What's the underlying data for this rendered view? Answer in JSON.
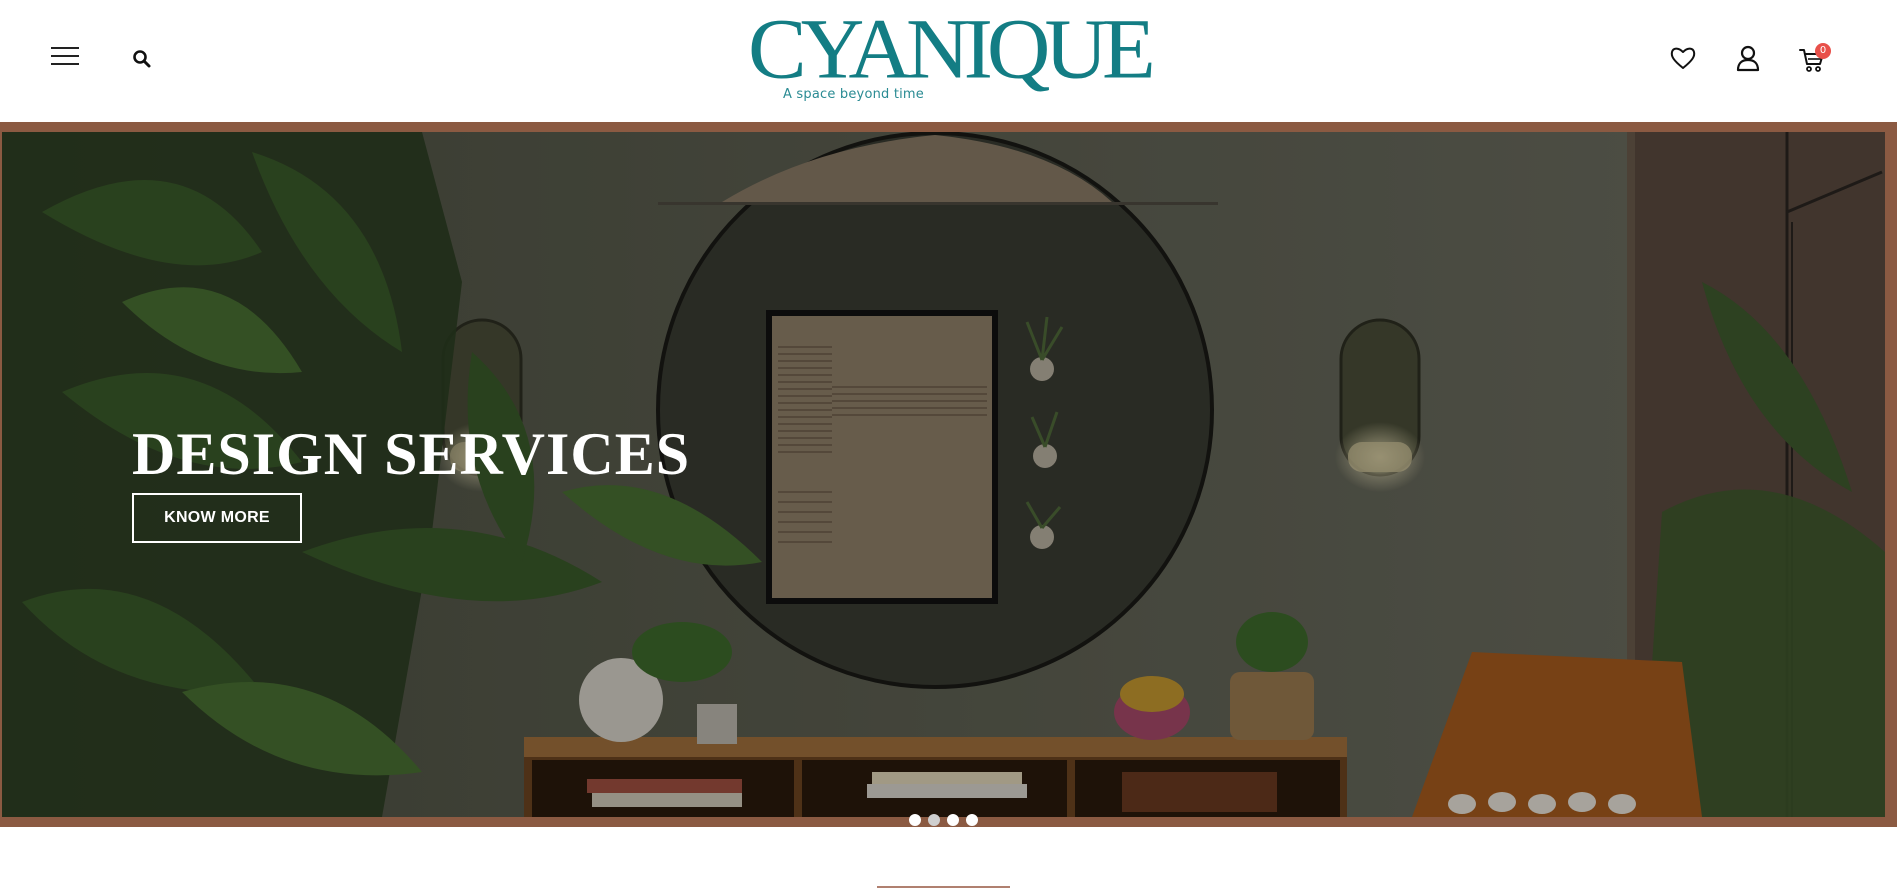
{
  "header": {
    "menu_icon": "hamburger-menu-icon",
    "search_icon": "search-icon",
    "logo_text": "CYANIQUE",
    "logo_tagline": "A space beyond time",
    "wishlist_icon": "heart-icon",
    "account_icon": "user-icon",
    "cart_icon": "cart-icon",
    "cart_count": "0",
    "brand_color": "#137d84",
    "badge_color": "#e8504a"
  },
  "hero": {
    "title": "DESIGN SERVICES",
    "cta_label": "KNOW MORE",
    "frame_color": "#8b5a42",
    "slides_total": 4,
    "active_slide": 1
  }
}
